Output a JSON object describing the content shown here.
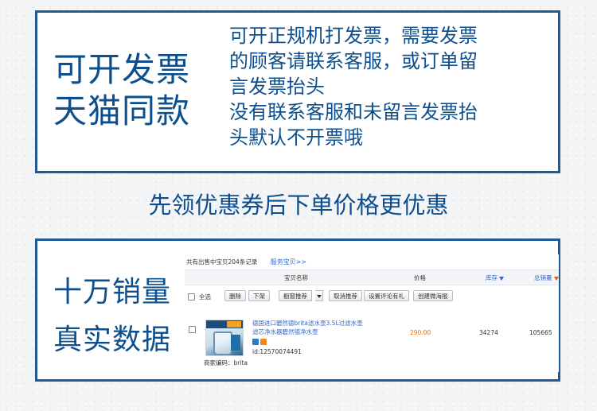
{
  "top_panel": {
    "title_lines": [
      "可开发票",
      "天猫同款"
    ],
    "description_lines": [
      "可开正规机打发票，需要发票",
      "的顾客请联系客服，或订单留",
      "言发票抬头",
      "没有联系客服和未留言发票抬",
      "头默认不开票哦"
    ]
  },
  "coupon_line": "先领优惠券后下单价格更优惠",
  "bottom_panel": {
    "title_lines": [
      "十万销量",
      "真实数据"
    ],
    "shot": {
      "summary": "共有出售中宝贝204条记录",
      "service_link": "服务宝贝>>",
      "columns": {
        "item": "宝贝名称",
        "price": "价格",
        "stock": "库存",
        "sales": "总销量"
      },
      "toolbar": {
        "select_all": "全选",
        "buttons": [
          "删除",
          "下架",
          "橱窗推荐",
          "取消推荐",
          "设置评论有礼",
          "创建微海报"
        ]
      },
      "item": {
        "title_lines": [
          "德国进口碧然德brita滤水壶3.5L过滤水壶",
          "滤芯净水器碧然德净水壶"
        ],
        "id": "id:12570074491",
        "merchant_code": "商家编码：brita",
        "price": "290.00",
        "stock": "34274",
        "sales": "105665"
      },
      "colors": {
        "link": "#3366cc",
        "price": "#f06c00",
        "sort_arrow_stock": "#3366cc",
        "sort_arrow_sales": "#e05a16"
      }
    }
  },
  "colors": {
    "accent_text": "#0d4f8e",
    "panel_border": "#1f5b93"
  }
}
